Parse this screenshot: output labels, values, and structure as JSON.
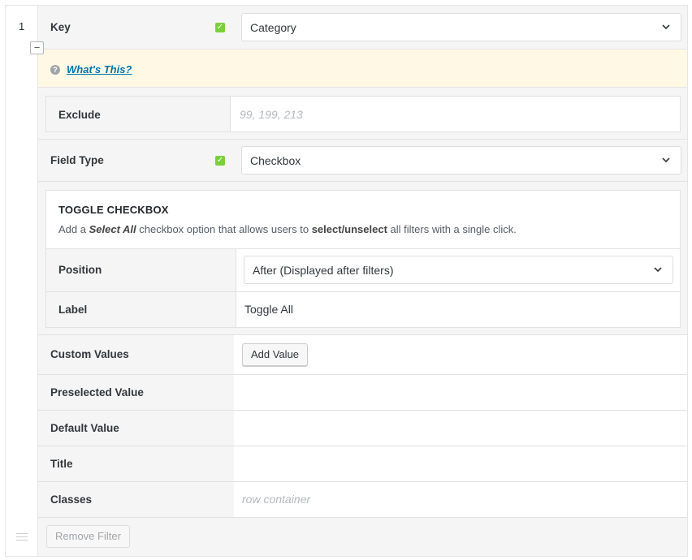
{
  "filter": {
    "row_number": "1",
    "collapse_symbol": "−",
    "key": {
      "label": "Key",
      "value": "Category"
    },
    "whats_this": {
      "icon": "question-icon",
      "link": "What's This?"
    },
    "exclude": {
      "label": "Exclude",
      "placeholder": "99, 199, 213"
    },
    "field_type": {
      "label": "Field Type",
      "value": "Checkbox"
    },
    "toggle_checkbox": {
      "heading": "TOGGLE CHECKBOX",
      "desc_part1": "Add a ",
      "desc_bold_italic": "Select All",
      "desc_part2": " checkbox option that allows users to ",
      "desc_bold": "select/unselect",
      "desc_part3": " all filters with a single click.",
      "position": {
        "label": "Position",
        "value": "After (Displayed after filters)"
      },
      "toggle_label": {
        "label": "Label",
        "value": "Toggle All"
      }
    },
    "custom_values": {
      "label": "Custom Values",
      "button": "Add Value"
    },
    "preselected_value": {
      "label": "Preselected Value",
      "value": ""
    },
    "default_value": {
      "label": "Default Value",
      "value": ""
    },
    "title": {
      "label": "Title",
      "value": ""
    },
    "classes": {
      "label": "Classes",
      "placeholder": "row container"
    },
    "remove_button": "Remove Filter"
  },
  "colors": {
    "check_green": "#7ad03a",
    "link_blue": "#0073aa",
    "notice_bg": "#fff8e5"
  }
}
